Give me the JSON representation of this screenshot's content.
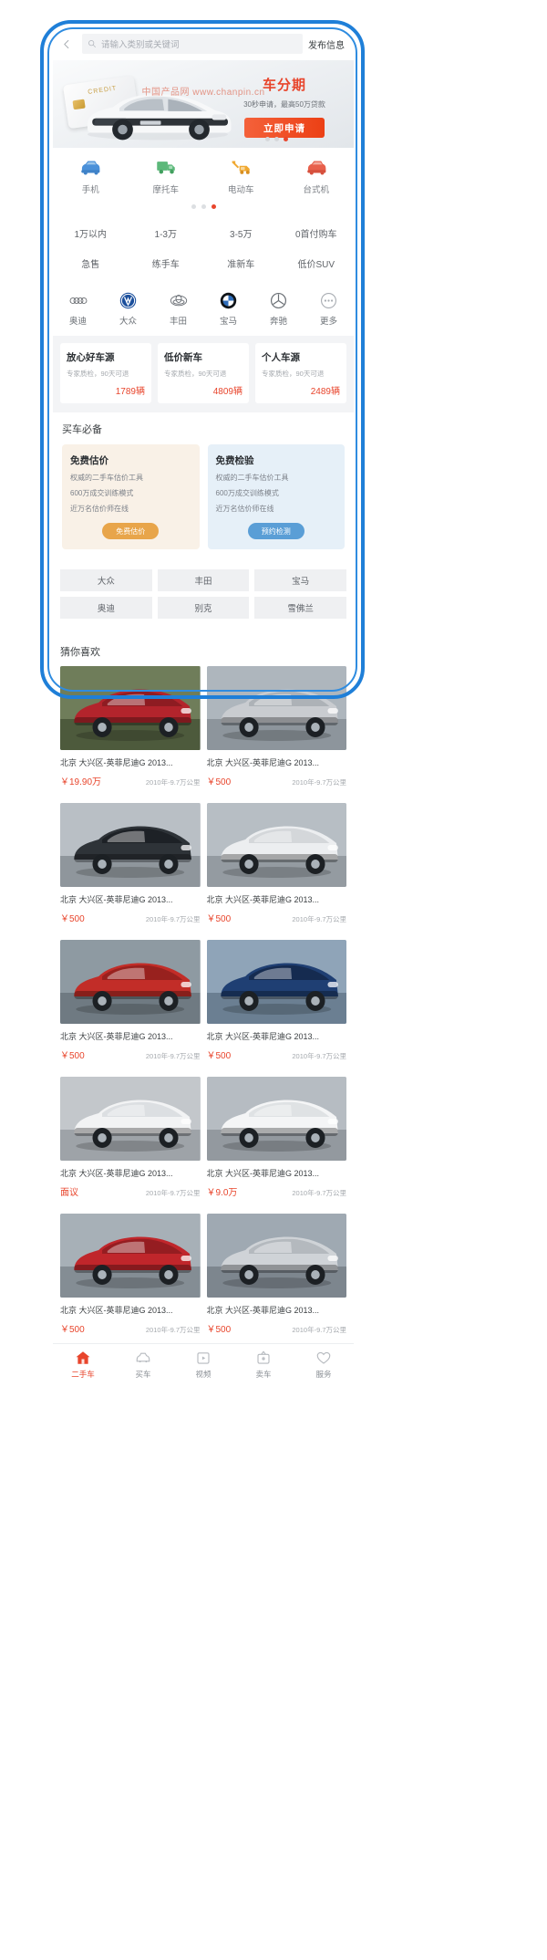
{
  "header": {
    "back_icon": "chevron-left-icon",
    "search_icon": "search-icon",
    "search_placeholder": "请输入类别或关键词",
    "publish_label": "发布信息"
  },
  "banner": {
    "card_text": "CREDIT",
    "title": "车分期",
    "subtitle": "30秒申请，最高50万贷款",
    "cta_label": "立即申请",
    "dots": 3,
    "active_dot": 2,
    "accent_color": "#e8452c"
  },
  "categories": {
    "items": [
      {
        "label": "手机",
        "icon": "car-icon",
        "color": "#4a90d9"
      },
      {
        "label": "摩托车",
        "icon": "truck-icon",
        "color": "#5cb87a"
      },
      {
        "label": "电动车",
        "icon": "tow-truck-icon",
        "color": "#f0a830"
      },
      {
        "label": "台式机",
        "icon": "red-car-icon",
        "color": "#e8604c"
      }
    ],
    "dots": 3,
    "active_dot": 2
  },
  "price_filters": {
    "rows": [
      [
        "1万以内",
        "1-3万",
        "3-5万",
        "0首付购车"
      ],
      [
        "急售",
        "练手车",
        "准新车",
        "低价SUV"
      ]
    ]
  },
  "brands": {
    "items": [
      {
        "label": "奥迪",
        "icon": "audi-logo-icon"
      },
      {
        "label": "大众",
        "icon": "volkswagen-logo-icon"
      },
      {
        "label": "丰田",
        "icon": "toyota-logo-icon"
      },
      {
        "label": "宝马",
        "icon": "bmw-logo-icon"
      },
      {
        "label": "奔驰",
        "icon": "mercedes-logo-icon"
      },
      {
        "label": "更多",
        "icon": "more-icon"
      }
    ]
  },
  "promos": [
    {
      "title": "放心好车源",
      "sub": "专家质检，90天可退",
      "count": "1789辆"
    },
    {
      "title": "低价新车",
      "sub": "专家质检，90天可退",
      "count": "4809辆"
    },
    {
      "title": "个人车源",
      "sub": "专家质检，90天可退",
      "count": "2489辆"
    }
  ],
  "musthave": {
    "section_title": "买车必备",
    "cards": [
      {
        "title": "免费估价",
        "lines": [
          "权威的二手车估价工具",
          "600万成交训练模式",
          "近万名估价师在线"
        ],
        "button": "免费估价",
        "theme": "beige"
      },
      {
        "title": "免费检验",
        "lines": [
          "权威的二手车估价工具",
          "600万成交训练模式",
          "近万名估价师在线"
        ],
        "button": "预约检测",
        "theme": "blue"
      }
    ]
  },
  "tag_grid": {
    "rows": [
      [
        "大众",
        "丰田",
        "宝马"
      ],
      [
        "奥迪",
        "别克",
        "雪佛兰"
      ]
    ]
  },
  "guess": {
    "section_title": "猜你喜欢",
    "watermark": "中国产品网 www.chanpin.cn",
    "items": [
      {
        "title": "北京 大兴区-英菲尼迪G 2013...",
        "price": "￥19.90万",
        "meta": "2010年-9.7万公里",
        "thumb": "red-sedan"
      },
      {
        "title": "北京 大兴区-英菲尼迪G 2013...",
        "price": "￥500",
        "meta": "2010年-9.7万公里",
        "thumb": "silver-sedan"
      },
      {
        "title": "北京 大兴区-英菲尼迪G 2013...",
        "price": "￥500",
        "meta": "2010年-9.7万公里",
        "thumb": "dark-sedan"
      },
      {
        "title": "北京 大兴区-英菲尼迪G 2013...",
        "price": "￥500",
        "meta": "2010年-9.7万公里",
        "thumb": "white-suv"
      },
      {
        "title": "北京 大兴区-英菲尼迪G 2013...",
        "price": "￥500",
        "meta": "2010年-9.7万公里",
        "thumb": "red-suv"
      },
      {
        "title": "北京 大兴区-英菲尼迪G 2013...",
        "price": "￥500",
        "meta": "2010年-9.7万公里",
        "thumb": "blue-coupe"
      },
      {
        "title": "北京 大兴区-英菲尼迪G 2013...",
        "price": "面议",
        "meta": "2010年-9.7万公里",
        "thumb": "white-luxury"
      },
      {
        "title": "北京 大兴区-英菲尼迪G 2013...",
        "price": "￥9.0万",
        "meta": "2010年-9.7万公里",
        "thumb": "white-hatch"
      },
      {
        "title": "北京 大兴区-英菲尼迪G 2013...",
        "price": "￥500",
        "meta": "2010年-9.7万公里",
        "thumb": "red-sports"
      },
      {
        "title": "北京 大兴区-英菲尼迪G 2013...",
        "price": "￥500",
        "meta": "2010年-9.7万公里",
        "thumb": "silver-wagon"
      }
    ]
  },
  "tabbar": {
    "items": [
      {
        "label": "二手车",
        "icon": "home-icon",
        "active": true
      },
      {
        "label": "买车",
        "icon": "car-icon",
        "active": false
      },
      {
        "label": "视频",
        "icon": "video-icon",
        "active": false
      },
      {
        "label": "卖车",
        "icon": "money-icon",
        "active": false
      },
      {
        "label": "服务",
        "icon": "heart-icon",
        "active": false
      }
    ],
    "active_color": "#e8452c",
    "inactive_color": "#8b9096"
  }
}
